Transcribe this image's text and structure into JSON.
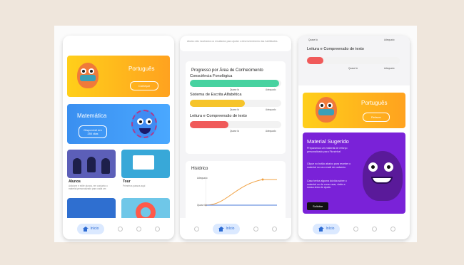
{
  "phone1": {
    "portugues": {
      "title": "Português",
      "button": "Começar"
    },
    "matematica": {
      "title": "Matemática",
      "button": "Disponível em 250 dias"
    },
    "alunos": {
      "label": "Alunos",
      "sub": "Adicione e edite alunos, em conjunto o material personalizado para cada um"
    },
    "tour": {
      "label": "Tour",
      "sub": "Primeiros passos aqui"
    },
    "nav_home": "Início"
  },
  "phone2": {
    "top_text": "Abaixo são mostrados os resultados para ajudar o desenvolvimento das habilidades.",
    "progress_title": "Progresso por Área de Conhecimento",
    "areas": [
      {
        "label": "Consciência Fonológica",
        "value": 0.98,
        "color": "#48d2a0",
        "tick_left": "Quase lá",
        "tick_right": "Adequado"
      },
      {
        "label": "Sistema de Escrita Alfabética",
        "value": 0.6,
        "color": "#f6c42a",
        "tick_left": "Quase lá",
        "tick_right": "Adequado"
      },
      {
        "label": "Leitura e Compreensão de texto",
        "value": 0.42,
        "color": "#f05a5a",
        "tick_left": "Quase lá",
        "tick_right": "Adequado"
      }
    ],
    "history_title": "Histórico",
    "history_y_top": "Adequado",
    "history_y_bottom": "Quase lá",
    "nav_home": "Início"
  },
  "phone3": {
    "area_label": "Leitura e Compreensão de texto",
    "area_value": 0.18,
    "area_color": "#f05a5a",
    "tick_left": "Quase lá",
    "tick_right": "Adequado",
    "portugues": {
      "title": "Português",
      "button": "Refazer"
    },
    "material": {
      "title": "Material Sugerido",
      "text1": "Preparamos um material de reforço personalizado para Florzinha!",
      "text2": "Clique no botão abaixo para receber o material no seu email de cadastro.",
      "text3": "Caso tenha alguma dúvida sobre o material ou de como usar, visite a nossa área de ajuda.",
      "button": "Solicitar"
    },
    "nav_home": "Início"
  }
}
